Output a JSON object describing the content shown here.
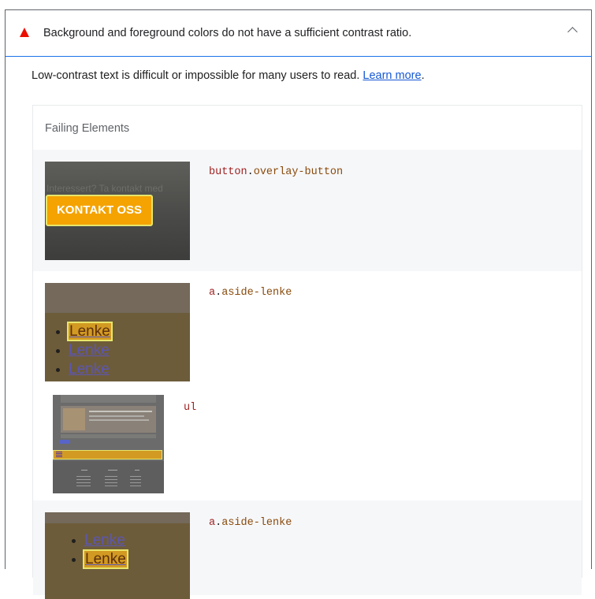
{
  "audit": {
    "title": "Background and foreground colors do not have a sufficient contrast ratio.",
    "description": "Low-contrast text is difficult or impossible for many users to read.",
    "learn_more": "Learn more",
    "description_end": ".",
    "warning_icon": "warning-triangle-icon",
    "collapse_icon": "chevron-up-icon",
    "colors": {
      "warning": "#eb0f00",
      "link": "#1558d6",
      "focus_border": "#1a73e8"
    }
  },
  "details": {
    "heading": "Failing Elements",
    "rows": [
      {
        "tag": "button",
        "dot": ".",
        "class": "overlay-button",
        "thumb_text": "KONTAKT OSS",
        "thumb_ghost": "Interessert? Ta kontakt med"
      },
      {
        "tag": "a",
        "dot": ".",
        "class": "aside-lenke",
        "thumb_links": [
          "Lenke",
          "Lenke",
          "Lenke"
        ]
      },
      {
        "tag": "ul",
        "dot": "",
        "class": ""
      },
      {
        "tag": "a",
        "dot": ".",
        "class": "aside-lenke",
        "thumb_links": [
          "Lenke",
          "Lenke"
        ]
      }
    ]
  }
}
